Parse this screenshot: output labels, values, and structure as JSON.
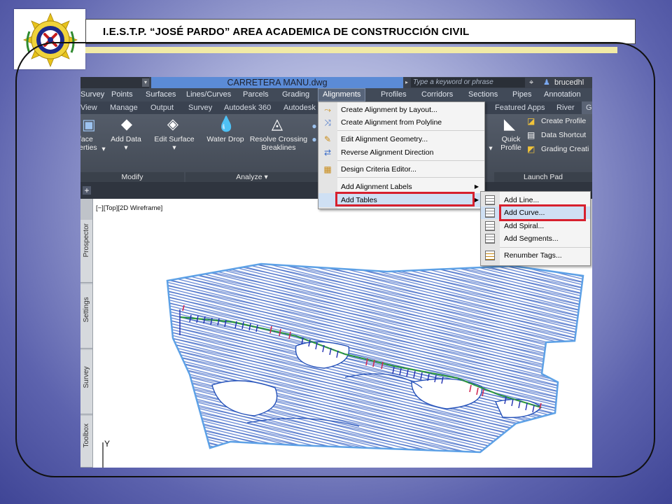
{
  "slide": {
    "title": "I.E.S.T.P. “JOSÉ PARDO” AREA ACADEMICA DE CONSTRUCCIÓN CIVIL",
    "colors": {
      "background_center": "#e4e6f6",
      "background_edge": "#3f4596",
      "strip": "#f1eaa6",
      "frame": "#111111"
    }
  },
  "app": {
    "file_title": "CARRETERA MANU.dwg",
    "search_placeholder": "Type a keyword or phrase",
    "user": "brucedhl",
    "ribbon_tabs": [
      "Survey",
      "Points",
      "Surfaces",
      "Lines/Curves",
      "Parcels",
      "Grading",
      "Alignments",
      "Profiles",
      "Corridors",
      "Sections",
      "Pipes",
      "Annotation"
    ],
    "active_tab": "Alignments",
    "secondary_tabs": [
      "View",
      "Manage",
      "Output",
      "Survey",
      "Autodesk 360",
      "Autodesk",
      "Featured Apps",
      "River",
      "G"
    ],
    "panels": {
      "modify_title": "Modify",
      "analyze_title": "Analyze",
      "launch_title": "Launch Pad",
      "buttons": {
        "surface_props_1": "face",
        "surface_props_2": "erties",
        "add_data": "Add Data",
        "edit_surface": "Edit Surface",
        "water_drop": "Water Drop",
        "resolve_1": "Resolve Crossing",
        "resolve_2": "Breaklines",
        "quick_profile_1": "Quick",
        "quick_profile_2": "Profile",
        "create_profile": "Create Profile",
        "data_shortcut": "Data Shortcut",
        "grading_creation": "Grading Creati"
      }
    },
    "viewport_label": "[−][Top][2D Wireframe]",
    "side_tabs": [
      "Prospector",
      "Settings",
      "Survey",
      "Toolbox"
    ],
    "axis_y": "Y",
    "alignments_menu": [
      "Create Alignment by Layout...",
      "Create Alignment from Polyline",
      "Edit Alignment Geometry...",
      "Reverse Alignment Direction",
      "Design Criteria Editor...",
      "Add Alignment Labels",
      "Add Tables"
    ],
    "tables_submenu": [
      "Add Line...",
      "Add Curve...",
      "Add Spiral...",
      "Add Segments...",
      "Renumber Tags..."
    ],
    "highlight_color": "#d7202e"
  }
}
